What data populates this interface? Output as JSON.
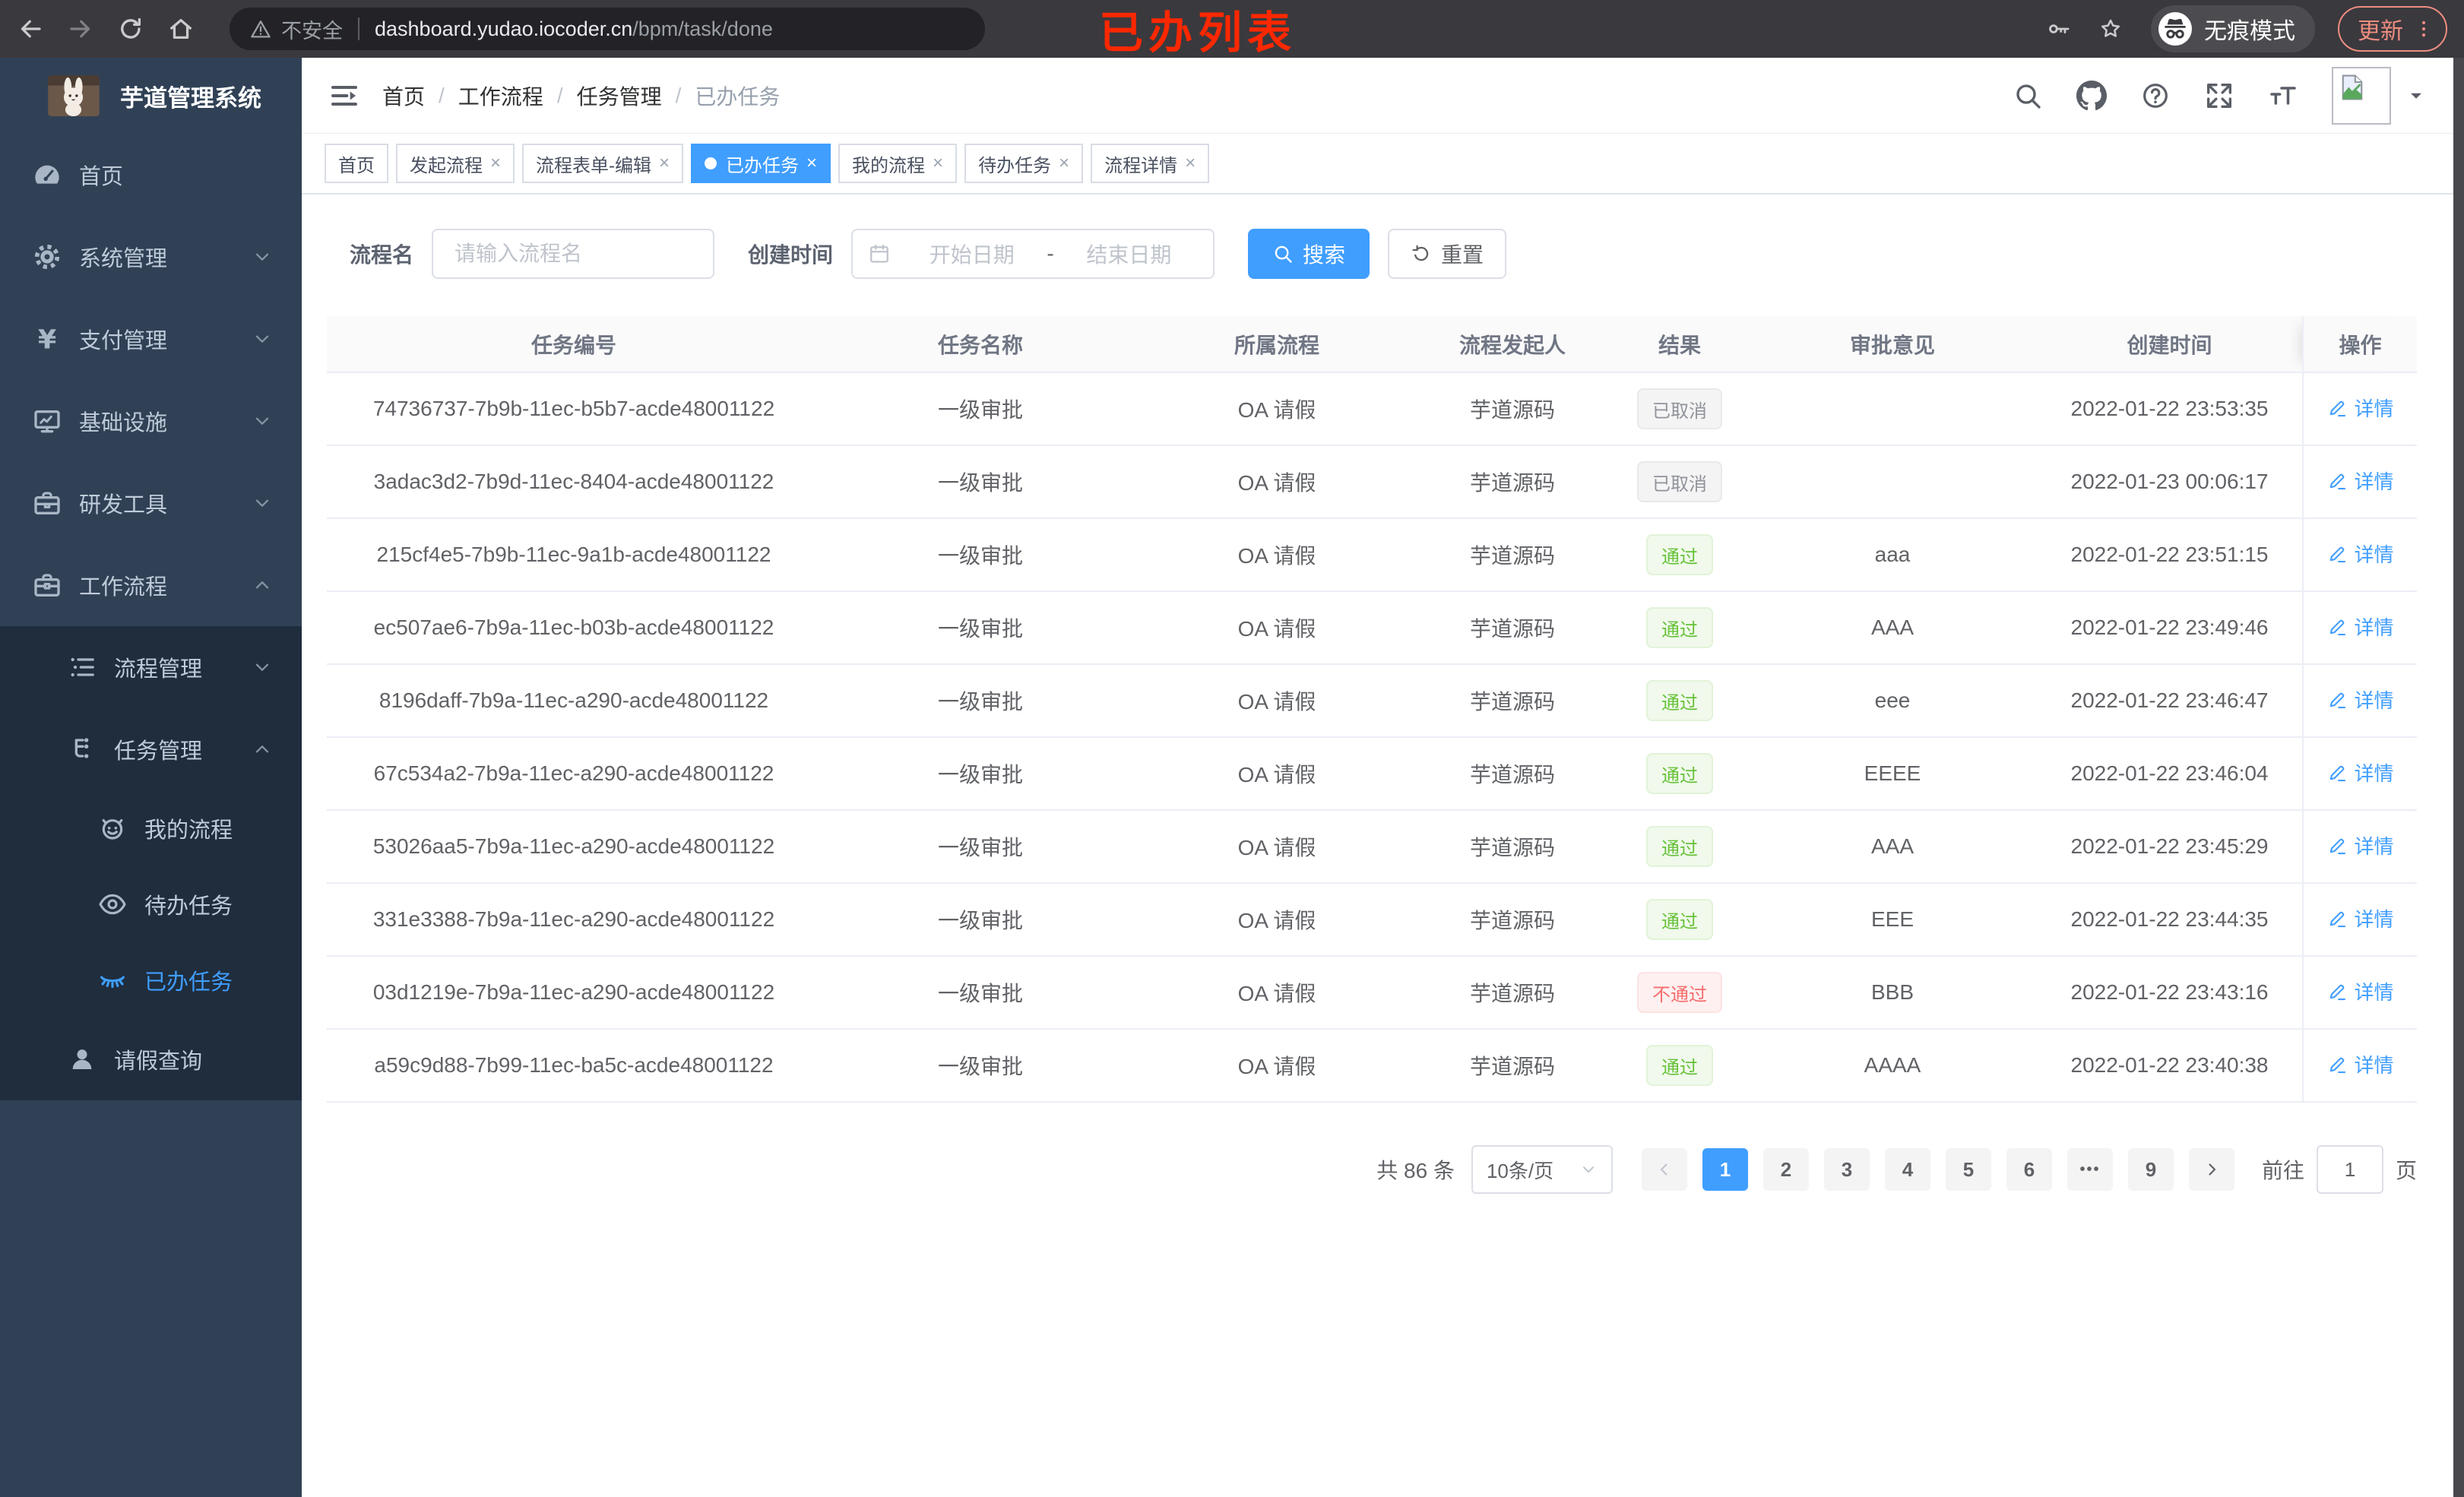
{
  "browser": {
    "security_label": "不安全",
    "url_host": "dashboard.yudao.iocoder.cn",
    "url_path": "/bpm/task/done",
    "incognito_label": "无痕模式",
    "update_label": "更新"
  },
  "annotation": {
    "text": "已办列表"
  },
  "ui": {
    "breadcrumb_separator": "/",
    "close_glyph": "×",
    "more_glyph": "•••"
  },
  "sidebar": {
    "app_title": "芋道管理系统",
    "menu": [
      {
        "icon": "dashboard-icon",
        "label": "首页",
        "level": 1
      },
      {
        "icon": "gear-icon",
        "label": "系统管理",
        "level": 1,
        "arrow": "down"
      },
      {
        "icon": "yen-icon",
        "label": "支付管理",
        "level": 1,
        "arrow": "down"
      },
      {
        "icon": "monitor-icon",
        "label": "基础设施",
        "level": 1,
        "arrow": "down"
      },
      {
        "icon": "toolbox-icon",
        "label": "研发工具",
        "level": 1,
        "arrow": "down"
      },
      {
        "icon": "briefcase-icon",
        "label": "工作流程",
        "level": 1,
        "arrow": "up"
      },
      {
        "icon": "list-tree-icon",
        "label": "流程管理",
        "level": 2,
        "arrow": "down",
        "sub": true
      },
      {
        "icon": "org-tree-icon",
        "label": "任务管理",
        "level": 2,
        "arrow": "up",
        "sub": true
      },
      {
        "icon": "robot-icon",
        "label": "我的流程",
        "level": 3,
        "sub": true
      },
      {
        "icon": "eye-icon",
        "label": "待办任务",
        "level": 3,
        "sub": true
      },
      {
        "icon": "eye-closed-icon",
        "label": "已办任务",
        "level": 3,
        "sub": true,
        "active": true
      },
      {
        "icon": "user-icon",
        "label": "请假查询",
        "level": 2,
        "sub": true
      }
    ]
  },
  "breadcrumb": [
    "首页",
    "工作流程",
    "任务管理",
    "已办任务"
  ],
  "tabs": [
    {
      "label": "首页",
      "closable": false
    },
    {
      "label": "发起流程",
      "closable": true
    },
    {
      "label": "流程表单-编辑",
      "closable": true
    },
    {
      "label": "已办任务",
      "closable": true,
      "active": true
    },
    {
      "label": "我的流程",
      "closable": true
    },
    {
      "label": "待办任务",
      "closable": true
    },
    {
      "label": "流程详情",
      "closable": true
    }
  ],
  "filter": {
    "name_label": "流程名",
    "name_placeholder": "请输入流程名",
    "time_label": "创建时间",
    "start_placeholder": "开始日期",
    "range_separator": "-",
    "end_placeholder": "结束日期",
    "search_label": "搜索",
    "reset_label": "重置"
  },
  "table": {
    "columns": [
      "任务编号",
      "任务名称",
      "所属流程",
      "流程发起人",
      "结果",
      "审批意见",
      "创建时间",
      "操作"
    ],
    "detail_label": "详情",
    "rows": [
      {
        "id": "74736737-7b9b-11ec-b5b7-acde48001122",
        "name": "一级审批",
        "process": "OA 请假",
        "starter": "芋道源码",
        "result": "已取消",
        "result_type": "info",
        "comment": "",
        "time": "2022-01-22 23:53:35"
      },
      {
        "id": "3adac3d2-7b9d-11ec-8404-acde48001122",
        "name": "一级审批",
        "process": "OA 请假",
        "starter": "芋道源码",
        "result": "已取消",
        "result_type": "info",
        "comment": "",
        "time": "2022-01-23 00:06:17"
      },
      {
        "id": "215cf4e5-7b9b-11ec-9a1b-acde48001122",
        "name": "一级审批",
        "process": "OA 请假",
        "starter": "芋道源码",
        "result": "通过",
        "result_type": "success",
        "comment": "aaa",
        "time": "2022-01-22 23:51:15"
      },
      {
        "id": "ec507ae6-7b9a-11ec-b03b-acde48001122",
        "name": "一级审批",
        "process": "OA 请假",
        "starter": "芋道源码",
        "result": "通过",
        "result_type": "success",
        "comment": "AAA",
        "time": "2022-01-22 23:49:46"
      },
      {
        "id": "8196daff-7b9a-11ec-a290-acde48001122",
        "name": "一级审批",
        "process": "OA 请假",
        "starter": "芋道源码",
        "result": "通过",
        "result_type": "success",
        "comment": "eee",
        "time": "2022-01-22 23:46:47"
      },
      {
        "id": "67c534a2-7b9a-11ec-a290-acde48001122",
        "name": "一级审批",
        "process": "OA 请假",
        "starter": "芋道源码",
        "result": "通过",
        "result_type": "success",
        "comment": "EEEE",
        "time": "2022-01-22 23:46:04"
      },
      {
        "id": "53026aa5-7b9a-11ec-a290-acde48001122",
        "name": "一级审批",
        "process": "OA 请假",
        "starter": "芋道源码",
        "result": "通过",
        "result_type": "success",
        "comment": "AAA",
        "time": "2022-01-22 23:45:29"
      },
      {
        "id": "331e3388-7b9a-11ec-a290-acde48001122",
        "name": "一级审批",
        "process": "OA 请假",
        "starter": "芋道源码",
        "result": "通过",
        "result_type": "success",
        "comment": "EEE",
        "time": "2022-01-22 23:44:35"
      },
      {
        "id": "03d1219e-7b9a-11ec-a290-acde48001122",
        "name": "一级审批",
        "process": "OA 请假",
        "starter": "芋道源码",
        "result": "不通过",
        "result_type": "danger",
        "comment": "BBB",
        "time": "2022-01-22 23:43:16"
      },
      {
        "id": "a59c9d88-7b99-11ec-ba5c-acde48001122",
        "name": "一级审批",
        "process": "OA 请假",
        "starter": "芋道源码",
        "result": "通过",
        "result_type": "success",
        "comment": "AAAA",
        "time": "2022-01-22 23:40:38"
      }
    ]
  },
  "pagination": {
    "total_label": "共 86 条",
    "page_size": "10条/页",
    "pages": [
      "1",
      "2",
      "3",
      "4",
      "5",
      "6",
      "•••",
      "9"
    ],
    "active_page": "1",
    "goto_label": "前往",
    "goto_value": "1",
    "goto_suffix": "页"
  },
  "colors": {
    "accent": "#409eff",
    "success": "#67c23a",
    "danger": "#f56c6c",
    "info": "#909399",
    "sidebar": "#304156",
    "submenu": "#1f2d3d"
  }
}
